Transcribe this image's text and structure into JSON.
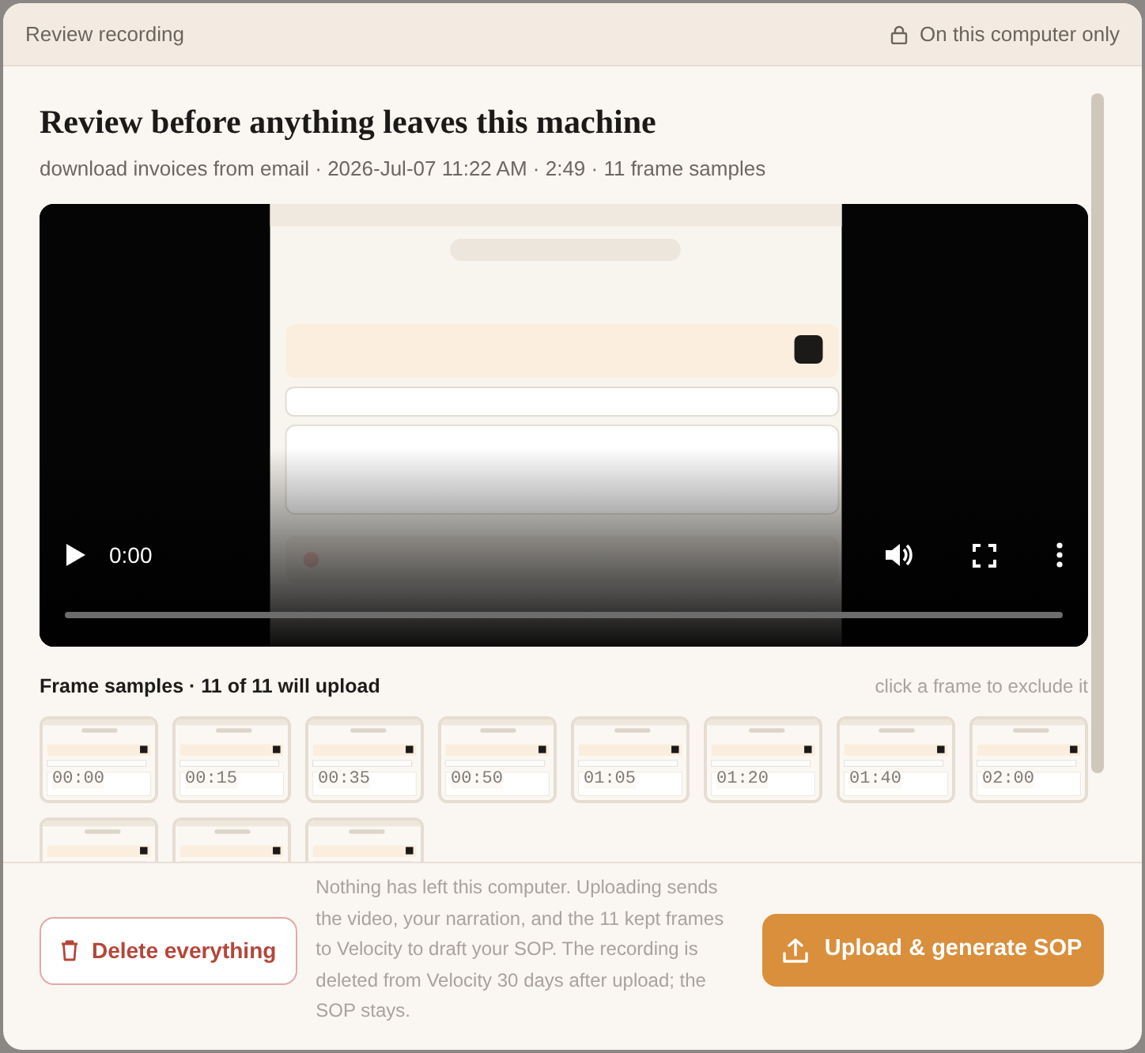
{
  "header": {
    "title": "Review recording",
    "privacy": "On this computer only"
  },
  "review": {
    "title": "Review before anything leaves this machine",
    "subtitle": "download invoices from email · 2026-Jul-07 11:22 AM · 2:49 · 11 frame samples"
  },
  "video": {
    "kind": "picture",
    "time": "0:00",
    "level": 0
  },
  "frames": {
    "heading": "Frame samples · 11 of 11 will upload",
    "hint": "click a frame to exclude it",
    "items": [
      {
        "kind": "picture",
        "time": "00:00"
      },
      {
        "kind": "picture",
        "time": "00:15"
      },
      {
        "kind": "picture",
        "time": "00:35"
      },
      {
        "kind": "picture",
        "time": "00:50"
      },
      {
        "kind": "picture",
        "time": "01:05"
      },
      {
        "kind": "picture",
        "time": "01:20"
      },
      {
        "kind": "picture",
        "time": "01:40"
      },
      {
        "kind": "picture",
        "time": "02:00"
      },
      {
        "kind": "picture"
      },
      {
        "kind": "picture"
      },
      {
        "kind": "picture"
      }
    ]
  },
  "footer": {
    "delete_label": "Delete everything",
    "notice": "Nothing has left this computer. Uploading sends the video, your narration, and the 11 kept frames to Velocity to draft your SOP. The recording is deleted from Velocity 30 days after upload; the SOP stays.",
    "upload_label": "Upload & generate SOP"
  }
}
